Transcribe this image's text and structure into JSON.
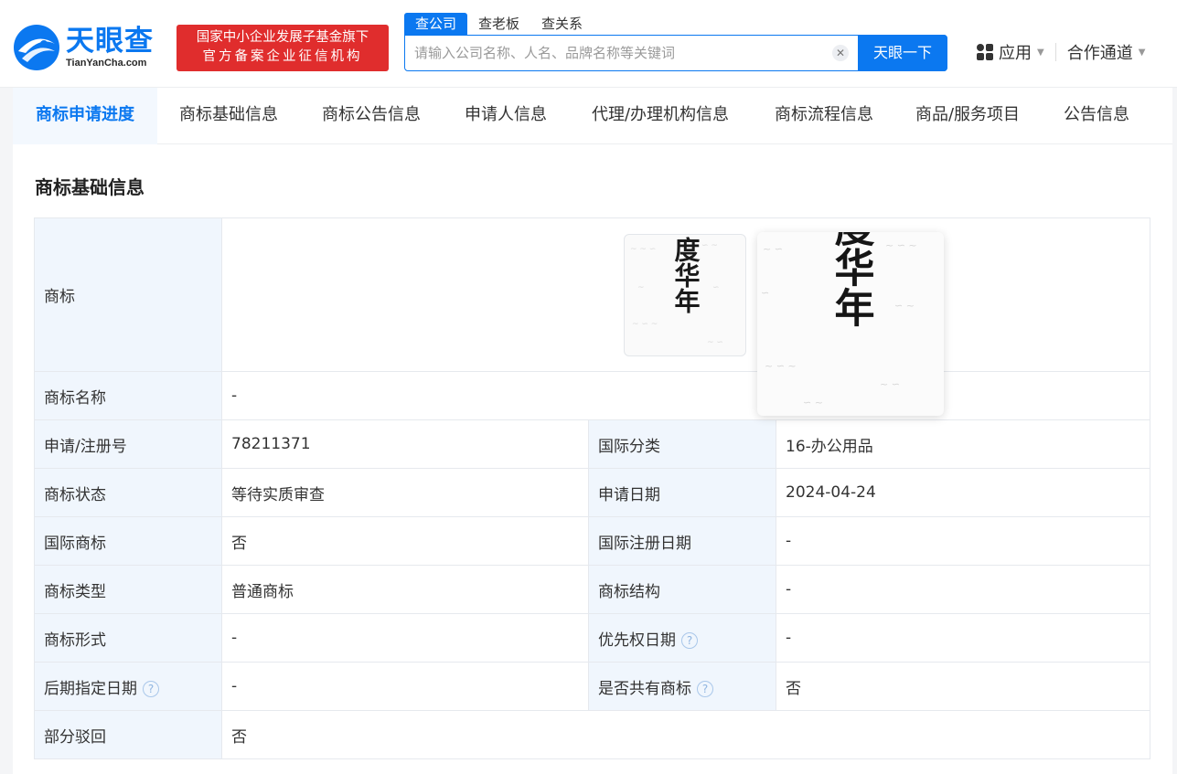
{
  "header": {
    "logo_cn": "天眼查",
    "logo_en": "TianYanCha.com",
    "badge_line1": "国家中小企业发展子基金旗下",
    "badge_line2": "官方备案企业征信机构",
    "search_tabs": [
      "查公司",
      "查老板",
      "查关系"
    ],
    "search_placeholder": "请输入公司名称、人名、品牌名称等关键词",
    "search_button": "天眼一下",
    "nav_apps": "应用",
    "nav_partner": "合作通道",
    "brand_color": "#0b78f0",
    "badge_color": "#e02d2d"
  },
  "tabs": [
    "商标申请进度",
    "商标基础信息",
    "商标公告信息",
    "申请人信息",
    "代理/办理机构信息",
    "商标流程信息",
    "商品/服务项目",
    "公告信息"
  ],
  "section": {
    "title": "商标基础信息"
  },
  "table": {
    "trademark_label": "商标",
    "trademark_glyphs": "度华年",
    "name_label": "商标名称",
    "name_value": "-",
    "rows": [
      {
        "l1": "申请/注册号",
        "v1": "78211371",
        "l2": "国际分类",
        "v2": "16-办公用品"
      },
      {
        "l1": "商标状态",
        "v1": "等待实质审查",
        "l2": "申请日期",
        "v2": "2024-04-24"
      },
      {
        "l1": "国际商标",
        "v1": "否",
        "l2": "国际注册日期",
        "v2": "-"
      },
      {
        "l1": "商标类型",
        "v1": "普通商标",
        "l2": "商标结构",
        "v2": "-"
      },
      {
        "l1": "商标形式",
        "v1": "-",
        "l2": "优先权日期",
        "v2": "-"
      },
      {
        "l1": "后期指定日期",
        "v1": "-",
        "l2": "是否共有商标",
        "v2": "否"
      }
    ],
    "partial_reject_label": "部分驳回",
    "partial_reject_value": "否"
  }
}
